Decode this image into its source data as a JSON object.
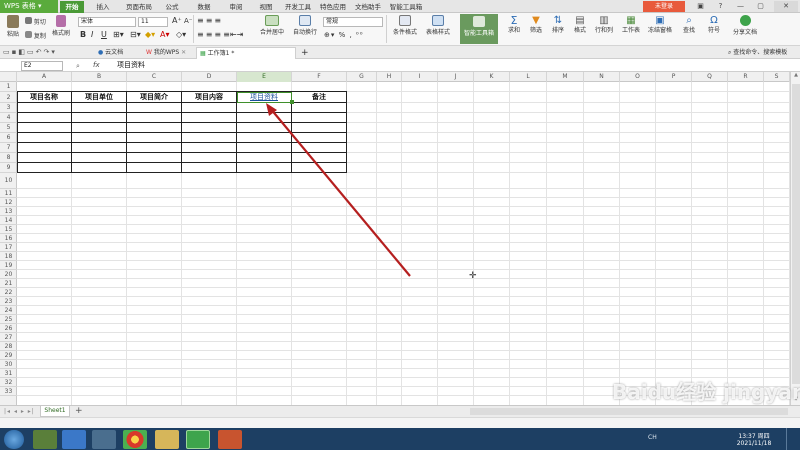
{
  "app": {
    "brand": "WPS 表格",
    "menu_tabs": [
      "开始",
      "插入",
      "页面布局",
      "公式",
      "数据",
      "审阅",
      "视图",
      "开发工具",
      "特色应用",
      "文档助手",
      "智能工具箱"
    ],
    "active_tab": "开始",
    "login_label": "未登录",
    "colors": {
      "brand_green": "#5aab3c",
      "active_tab": "#4a9a36",
      "login_red": "#e85a3c",
      "arrow_red": "#b51f1f",
      "taskbar": "#1d3f63"
    }
  },
  "ribbon": {
    "paste": "粘贴",
    "cut": "剪切",
    "copy": "复制",
    "format_painter": "格式刷",
    "font_name": "宋体",
    "font_size": "11",
    "bold": "B",
    "italic": "I",
    "underline": "U",
    "merge_center": "合并居中",
    "wrap_text": "自动换行",
    "number_format": "常规",
    "conditional_format": "条件格式",
    "table_style": "表格样式",
    "smart_toolbox": "智能工具箱",
    "sum": "求和",
    "filter": "筛选",
    "sort": "排序",
    "format": "格式",
    "row_col": "行和列",
    "worksheet": "工作表",
    "freeze": "冻结窗格",
    "find": "查找",
    "symbol": "符号",
    "share": "分享文档",
    "search_hint": "查找命令、搜索模板"
  },
  "doc_tabs": [
    "云文档",
    "我的WPS",
    "工作簿1 *"
  ],
  "formula_bar": {
    "name_box": "E2",
    "fx": "fx",
    "content": "项目资料"
  },
  "sheet": {
    "columns": [
      "A",
      "B",
      "C",
      "D",
      "E",
      "F",
      "G",
      "H",
      "I",
      "J",
      "K",
      "L",
      "M",
      "N",
      "O",
      "P",
      "Q",
      "R",
      "S"
    ],
    "rows": [
      "1",
      "2",
      "3",
      "4",
      "5",
      "6",
      "7",
      "8",
      "9",
      "10",
      "11",
      "12",
      "13",
      "14",
      "15",
      "16",
      "17",
      "18",
      "19",
      "20",
      "21",
      "22",
      "23",
      "24",
      "25",
      "26",
      "27",
      "28",
      "29",
      "30",
      "31",
      "32",
      "33"
    ],
    "selected_cell": "E2",
    "table_headers": [
      "项目名称",
      "项目单位",
      "项目简介",
      "项目内容",
      "项目资料",
      "备注"
    ],
    "sheet_tabs": [
      "Sheet1"
    ],
    "add_sheet": "+"
  },
  "taskbar": {
    "time": "13:37 周四",
    "date": "2021/11/18",
    "lang": "CH"
  },
  "watermark": "Baidu经验 jingyan.baidu.com"
}
